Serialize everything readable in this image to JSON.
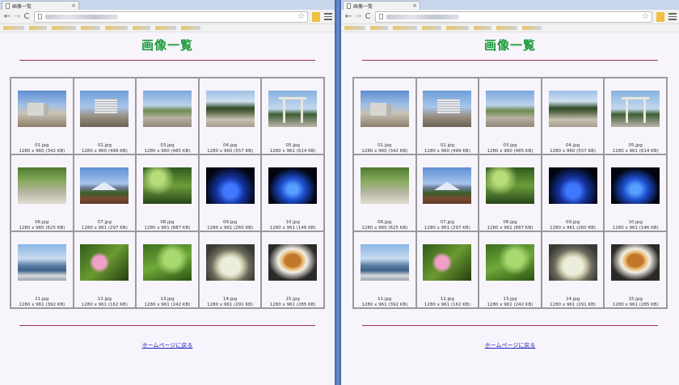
{
  "windows": [
    {
      "tab": {
        "title": "画像一覧"
      },
      "page": {
        "title": "画像一覧",
        "home_link": "ホームページに戻る",
        "images": [
          {
            "name": "01.jpg",
            "info": "1280 x 960 (342 KB)",
            "thumb": "t-beach-building"
          },
          {
            "name": "02.jpg",
            "info": "1280 x 960 (499 KB)",
            "thumb": "t-hotel"
          },
          {
            "name": "03.jpg",
            "info": "1280 x 960 (485 KB)",
            "thumb": "t-street"
          },
          {
            "name": "04.jpg",
            "info": "1280 x 960 (557 KB)",
            "thumb": "t-shrine-path"
          },
          {
            "name": "05.jpg",
            "info": "1280 x 961 (614 KB)",
            "thumb": "t-torii"
          },
          {
            "name": "06.jpg",
            "info": "1280 x 960 (625 KB)",
            "thumb": "t-forest-path"
          },
          {
            "name": "07.jpg",
            "info": "1280 x 961 (297 KB)",
            "thumb": "t-fuji"
          },
          {
            "name": "08.jpg",
            "info": "1280 x 961 (687 KB)",
            "thumb": "t-green-forest"
          },
          {
            "name": "09.jpg",
            "info": "1280 x 961 (260 KB)",
            "thumb": "t-blue-light1"
          },
          {
            "name": "10.jpg",
            "info": "1280 x 961 (146 KB)",
            "thumb": "t-blue-light2"
          },
          {
            "name": "11.jpg",
            "info": "1280 x 961 (392 KB)",
            "thumb": "t-sea-rocks"
          },
          {
            "name": "12.jpg",
            "info": "1280 x 961 (162 KB)",
            "thumb": "t-pink-flower"
          },
          {
            "name": "13.jpg",
            "info": "1280 x 961 (242 KB)",
            "thumb": "t-green-leaves"
          },
          {
            "name": "14.jpg",
            "info": "1280 x 961 (291 KB)",
            "thumb": "t-cake"
          },
          {
            "name": "15.jpg",
            "info": "1280 x 961 (285 KB)",
            "thumb": "t-burger"
          }
        ]
      }
    },
    {
      "tab": {
        "title": "画像一覧"
      },
      "page": {
        "title": "画像一覧",
        "home_link": "ホームページに戻る",
        "images": [
          {
            "name": "01.jpg",
            "info": "1280 x 960 (342 KB)",
            "thumb": "t-beach-building"
          },
          {
            "name": "02.jpg",
            "info": "1280 x 960 (499 KB)",
            "thumb": "t-hotel"
          },
          {
            "name": "03.jpg",
            "info": "1280 x 960 (485 KB)",
            "thumb": "t-street"
          },
          {
            "name": "04.jpg",
            "info": "1280 x 960 (557 KB)",
            "thumb": "t-shrine-path"
          },
          {
            "name": "05.jpg",
            "info": "1280 x 961 (614 KB)",
            "thumb": "t-torii"
          },
          {
            "name": "06.jpg",
            "info": "1280 x 960 (625 KB)",
            "thumb": "t-forest-path"
          },
          {
            "name": "07.jpg",
            "info": "1280 x 961 (297 KB)",
            "thumb": "t-fuji"
          },
          {
            "name": "08.jpg",
            "info": "1280 x 961 (687 KB)",
            "thumb": "t-green-forest"
          },
          {
            "name": "09.jpg",
            "info": "1280 x 961 (260 KB)",
            "thumb": "t-blue-light1"
          },
          {
            "name": "10.jpg",
            "info": "1280 x 961 (146 KB)",
            "thumb": "t-blue-light2"
          },
          {
            "name": "11.jpg",
            "info": "1280 x 961 (392 KB)",
            "thumb": "t-sea-rocks"
          },
          {
            "name": "12.jpg",
            "info": "1280 x 961 (162 KB)",
            "thumb": "t-pink-flower"
          },
          {
            "name": "13.jpg",
            "info": "1280 x 961 (242 KB)",
            "thumb": "t-green-leaves"
          },
          {
            "name": "14.jpg",
            "info": "1280 x 961 (291 KB)",
            "thumb": "t-cake"
          },
          {
            "name": "15.jpg",
            "info": "1280 x 961 (285 KB)",
            "thumb": "t-burger"
          }
        ]
      }
    }
  ],
  "colors": {
    "title": "#1a9a3a",
    "rule": "#a03050",
    "link": "#2020c0",
    "grid": "#9a9a9a"
  },
  "icons": {
    "back": "back-arrow-icon",
    "forward": "forward-arrow-icon",
    "reload": "reload-icon",
    "bookmark": "star-icon",
    "menu": "menu-icon"
  }
}
